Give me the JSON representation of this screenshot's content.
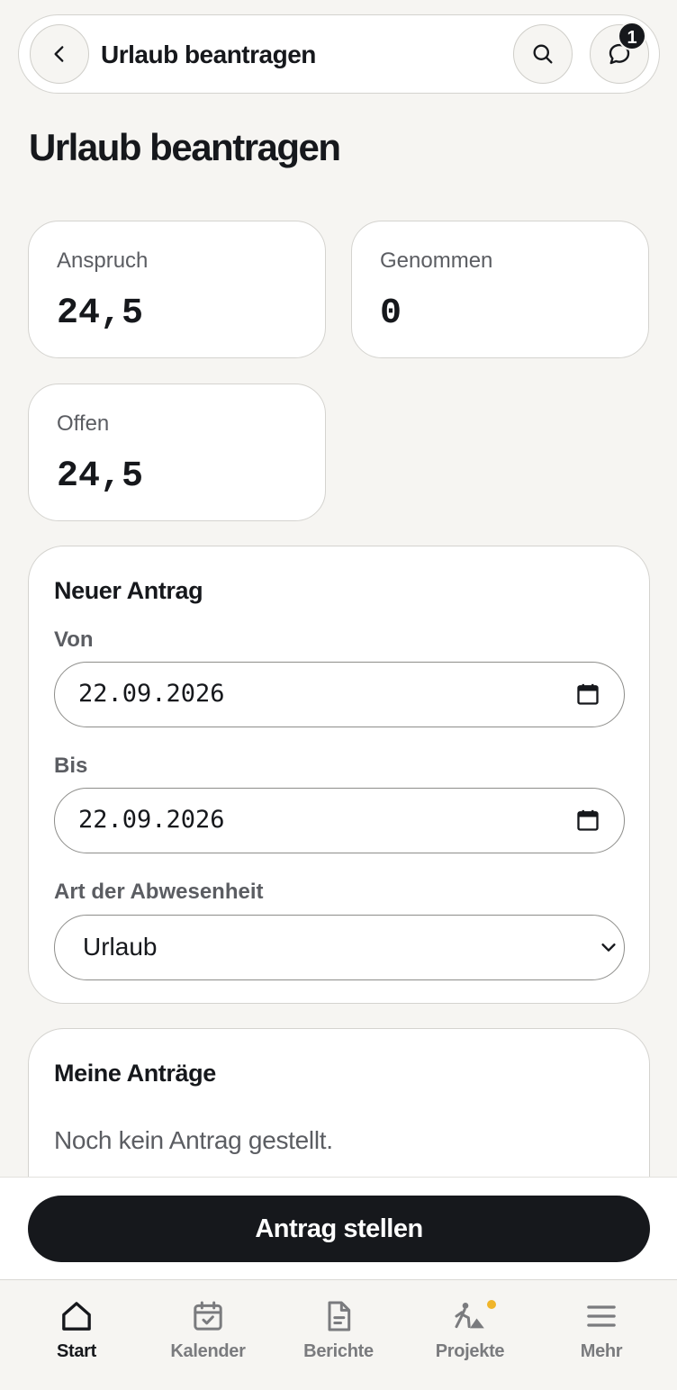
{
  "header": {
    "title": "Urlaub beantragen",
    "notification_count": "1",
    "back_icon": "chevron-left-icon",
    "search_icon": "search-icon",
    "chat_icon": "chat-icon"
  },
  "page": {
    "title": "Urlaub beantragen"
  },
  "stats": [
    {
      "label": "Anspruch",
      "value": "24,5"
    },
    {
      "label": "Genommen",
      "value": "0"
    },
    {
      "label": "Offen",
      "value": "24,5"
    }
  ],
  "form": {
    "title": "Neuer Antrag",
    "from_label": "Von",
    "from_value": "22.09.2026",
    "to_label": "Bis",
    "to_value": "22.09.2026",
    "type_label": "Art der Abwesenheit",
    "type_value": "Urlaub"
  },
  "requests": {
    "title": "Meine Anträge",
    "empty_text": "Noch kein Antrag gestellt."
  },
  "actions": {
    "submit_label": "Antrag stellen"
  },
  "nav": [
    {
      "label": "Start",
      "icon": "home-icon",
      "active": true
    },
    {
      "label": "Kalender",
      "icon": "calendar-check-icon"
    },
    {
      "label": "Berichte",
      "icon": "document-icon"
    },
    {
      "label": "Projekte",
      "icon": "construction-worker-icon",
      "indicator": true
    },
    {
      "label": "Mehr",
      "icon": "menu-icon"
    }
  ],
  "colors": {
    "background": "#f6f5f2",
    "primary": "#16181c",
    "indicator": "#f0b52a"
  }
}
